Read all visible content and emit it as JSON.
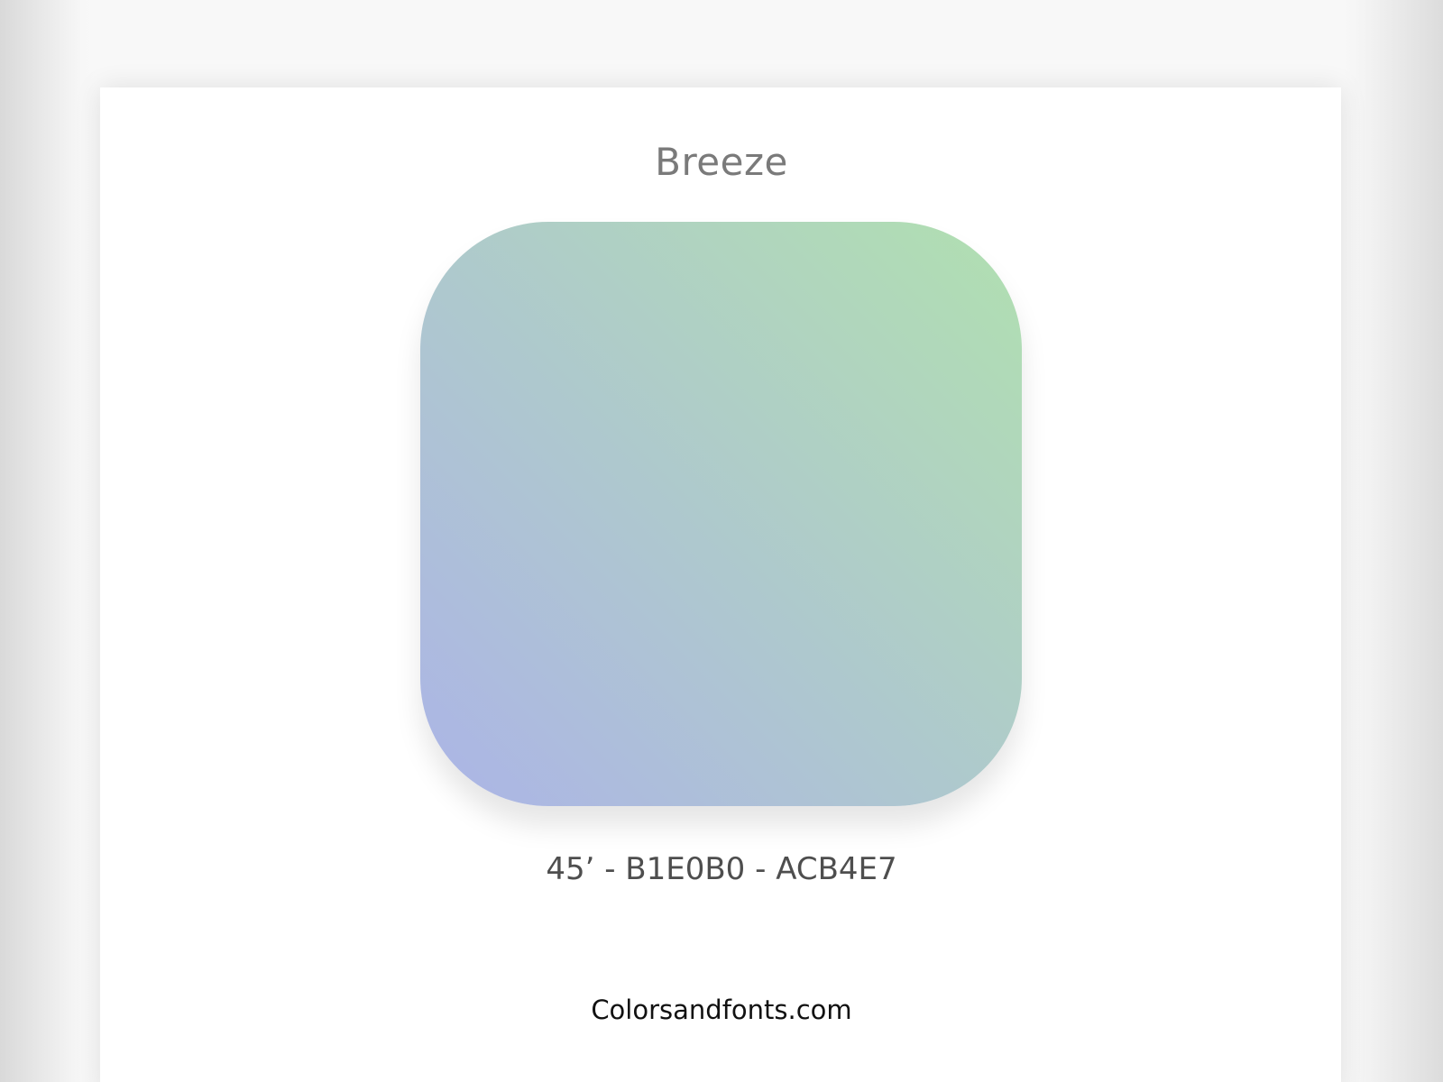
{
  "gradient": {
    "name": "Breeze",
    "angle_deg": 45,
    "color_start": "#B1E0B0",
    "color_end": "#ACB4E7",
    "caption": "45’ - B1E0B0 - ACB4E7"
  },
  "footer": {
    "site": "Colorsandfonts.com"
  }
}
